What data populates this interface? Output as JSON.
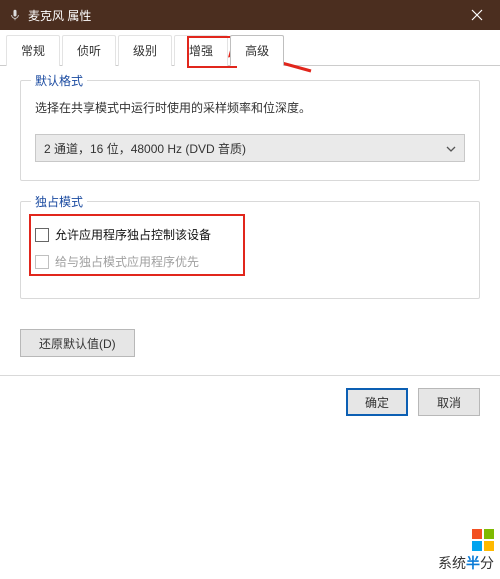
{
  "window": {
    "title": "麦克风 属性"
  },
  "tabs": {
    "items": [
      {
        "label": "常规"
      },
      {
        "label": "侦听"
      },
      {
        "label": "级别"
      },
      {
        "label": "增强"
      },
      {
        "label": "高级"
      }
    ],
    "active_index": 4
  },
  "default_format": {
    "legend": "默认格式",
    "desc": "选择在共享模式中运行时使用的采样频率和位深度。",
    "combo_value": "2 通道，16 位，48000 Hz (DVD 音质)"
  },
  "exclusive": {
    "legend": "独占模式",
    "allow_label": "允许应用程序独占控制该设备",
    "allow_checked": false,
    "priority_label": "给与独占模式应用程序优先",
    "priority_checked": false,
    "priority_enabled": false
  },
  "buttons": {
    "restore": "还原默认值(D)",
    "ok": "确定",
    "cancel": "取消"
  },
  "watermark": {
    "text_a": "系统",
    "text_b": "半",
    "text_c": "分"
  }
}
